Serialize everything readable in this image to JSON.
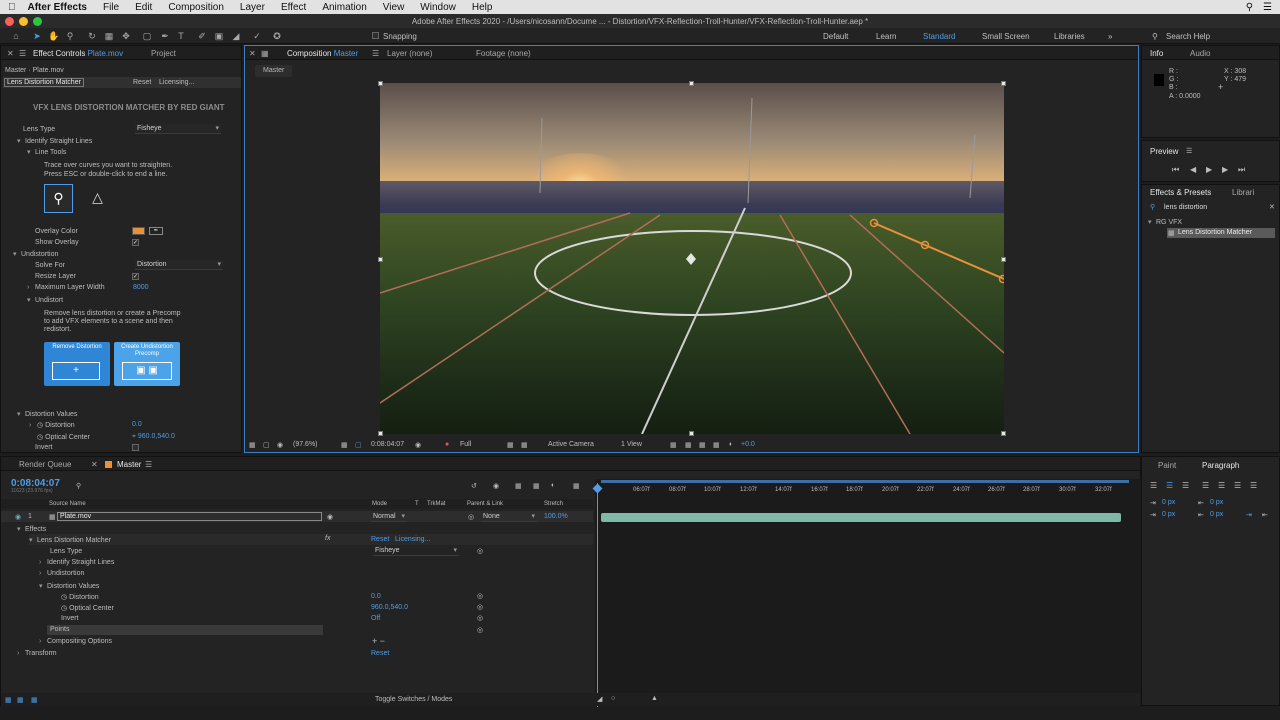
{
  "menubar": {
    "app": "After Effects",
    "items": [
      "File",
      "Edit",
      "Composition",
      "Layer",
      "Effect",
      "Animation",
      "View",
      "Window",
      "Help"
    ]
  },
  "window_title": "Adobe After Effects 2020 - /Users/nicosann/Docume ... - Distortion/VFX-Reflection-Troll-Hunter/VFX-Reflection-Troll-Hunter.aep *",
  "toolbar": {
    "snapping": "Snapping",
    "workspaces": [
      "Default",
      "Learn",
      "Standard",
      "Small Screen",
      "Libraries"
    ],
    "search_placeholder": "Search Help"
  },
  "effect_controls": {
    "tab": "Effect Controls",
    "tab_layer": "Plate.mov",
    "tab2": "Project",
    "path": "Master · Plate.mov",
    "effect_name": "Lens Distortion Matcher",
    "reset": "Reset",
    "licensing": "Licensing...",
    "banner": "VFX LENS DISTORTION MATCHER BY RED GIANT",
    "lens_type_label": "Lens Type",
    "lens_type_value": "Fisheye",
    "identify": "Identify Straight Lines",
    "line_tools": "Line Tools",
    "instructions": [
      "Trace over curves you want to straighten.",
      "Press ESC or double-click to end a line."
    ],
    "overlay_color": "Overlay Color",
    "show_overlay": "Show Overlay",
    "undistortion": "Undistortion",
    "solve_for": "Solve For",
    "solve_value": "Distortion",
    "resize_layer": "Resize Layer",
    "max_width": "Maximum Layer Width",
    "max_width_value": "8000",
    "undistort": "Undistort",
    "undistort_text": [
      "Remove lens distortion or create a Precomp",
      "to add VFX elements to a scene and then",
      "redistort."
    ],
    "btn_remove": "Remove Distortion",
    "btn_create": "Create Undistortion Precomp",
    "distortion_values": "Distortion Values",
    "distortion": "Distortion",
    "distortion_value": "0.0",
    "optical_center": "Optical Center",
    "optical_value": "960.0,540.0",
    "invert": "Invert",
    "overlay_color_hex": "#e8913a"
  },
  "composition": {
    "tab": "Composition",
    "tab_name": "Master",
    "tab_layer": "Layer (none)",
    "tab_footage": "Footage (none)",
    "subtab": "Master",
    "zoom": "(97.6%)",
    "time": "0:08:04:07",
    "resolution": "Full",
    "camera": "Active Camera",
    "view": "1 View",
    "exposure": "+0.0"
  },
  "info": {
    "tab": "Info",
    "tab2": "Audio",
    "r": "R :",
    "g": "G :",
    "b": "B :",
    "a": "A : 0.0000",
    "x": "X : 308",
    "y": "Y : 479"
  },
  "preview": {
    "tab": "Preview"
  },
  "effects_presets": {
    "tab": "Effects & Presets",
    "tab2": "Librari",
    "search": "lens distortion",
    "group": "RG VFX",
    "item": "Lens Distortion Matcher"
  },
  "timeline": {
    "render_queue": "Render Queue",
    "comp_tab": "Master",
    "timecode": "0:08:04:07",
    "fps": "11623 (23.976 fps)",
    "col_source": "Source Name",
    "col_mode": "Mode",
    "col_t": "T",
    "col_trkmat": "TrkMat",
    "col_parent": "Parent & Link",
    "col_stretch": "Stretch",
    "layer_num": "1",
    "layer_name": "Plate.mov",
    "layer_mode": "Normal",
    "layer_parent": "None",
    "layer_stretch": "100.0%",
    "effects": "Effects",
    "effect": "Lens Distortion Matcher",
    "reset": "Reset",
    "licensing": "Licensing...",
    "lens_type": "Lens Type",
    "lens_type_value": "Fisheye",
    "identify": "Identify Straight Lines",
    "undistortion": "Undistortion",
    "distortion_values": "Distortion Values",
    "distortion": "Distortion",
    "distortion_value": "0.0",
    "optical_center": "Optical Center",
    "optical_value": "960.0,540.0",
    "invert": "Invert",
    "invert_value": "Off",
    "points": "Points",
    "compositing": "Compositing Options",
    "transform": "Transform",
    "transform_reset": "Reset",
    "ticks": [
      "06:07f",
      "08:07f",
      "10:07f",
      "12:07f",
      "14:07f",
      "16:07f",
      "18:07f",
      "20:07f",
      "22:07f",
      "24:07f",
      "26:07f",
      "28:07f",
      "30:07f",
      "32:07f"
    ],
    "toggle": "Toggle Switches / Modes"
  },
  "paragraph": {
    "tab": "Paint",
    "tab2": "Paragraph",
    "px": "0 px"
  }
}
